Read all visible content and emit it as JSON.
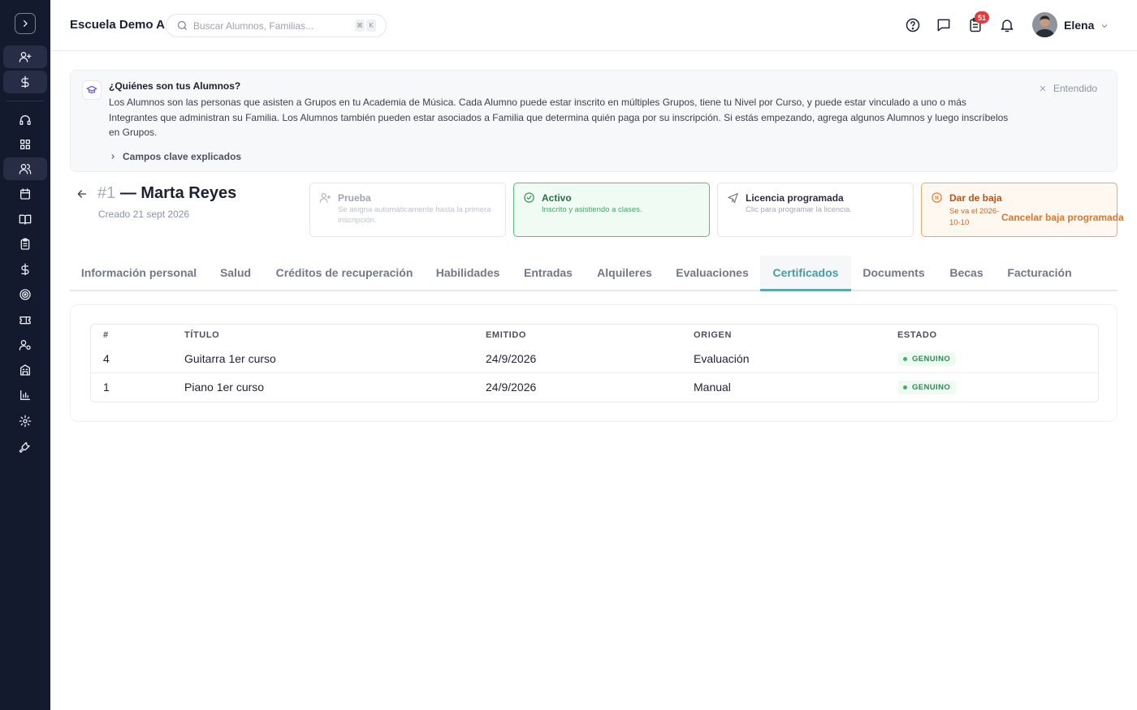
{
  "app": {
    "school_name": "Escuela Demo A",
    "search": {
      "placeholder": "Buscar Alumnos, Familias...",
      "shortcut": [
        "⌘",
        "K"
      ]
    },
    "notifications_count": "51",
    "user": {
      "name": "Elena"
    }
  },
  "sidebar": {
    "items": [
      {
        "icon": "user-plus-icon"
      },
      {
        "icon": "dollar-icon"
      },
      {
        "icon": "headset-icon"
      },
      {
        "icon": "dashboard-icon"
      },
      {
        "icon": "users-icon",
        "active": true
      },
      {
        "icon": "calendar-icon"
      },
      {
        "icon": "book-icon"
      },
      {
        "icon": "clipboard-icon"
      },
      {
        "icon": "dollar-icon"
      },
      {
        "icon": "target-icon"
      },
      {
        "icon": "ticket-icon"
      },
      {
        "icon": "user-settings-icon"
      },
      {
        "icon": "building-icon"
      },
      {
        "icon": "bar-chart-icon"
      },
      {
        "icon": "gear-icon"
      },
      {
        "icon": "wrench-icon"
      }
    ]
  },
  "banner": {
    "title": "¿Quiénes son tus Alumnos?",
    "text": "Los Alumnos son las personas que asisten a Grupos en tu Academia de Música. Cada Alumno puede estar inscrito en múltiples Grupos, tiene tu Nivel por Curso, y puede estar vinculado a uno o más Integrantes que administran su Familia. Los Alumnos también pueden estar asociados a Familia que determina quién paga por su inscripción. Si estás empezando, agrega algunos Alumnos y luego inscríbelos en Grupos.",
    "more_label": "Campos clave explicados",
    "dismiss_label": "Entendido"
  },
  "student": {
    "number": "#1",
    "name": "— Marta Reyes",
    "created": "Creado 21 sept 2026"
  },
  "status_cards": [
    {
      "title": "Prueba",
      "desc": "Se asigna automáticamente hasta la primera inscripción."
    },
    {
      "title": "Activo",
      "desc": "Inscrito y asistiendo a clases."
    },
    {
      "title": "Licencia programada",
      "desc": "Clic para programar la licencia."
    },
    {
      "title": "Dar de baja",
      "desc": "Se va el 2026-10-10"
    }
  ],
  "cancel_withdrawal_label": "Cancelar baja programada",
  "tabs": [
    "Información personal",
    "Salud",
    "Créditos de recuperación",
    "Habilidades",
    "Entradas",
    "Alquileres",
    "Evaluaciones",
    "Certificados",
    "Documents",
    "Becas",
    "Facturación"
  ],
  "active_tab": "Certificados",
  "table": {
    "headers": [
      "#",
      "TÍTULO",
      "EMITIDO",
      "ORIGEN",
      "ESTADO"
    ],
    "rows": [
      {
        "num": "4",
        "title": "Guitarra 1er curso",
        "issued": "24/9/2026",
        "origin": "Evaluación",
        "status": "GENUINO"
      },
      {
        "num": "1",
        "title": "Piano 1er curso",
        "issued": "24/9/2026",
        "origin": "Manual",
        "status": "GENUINO"
      }
    ]
  },
  "colors": {
    "sidebar_bg": "#141a2e",
    "accent_teal": "#4a9ba3",
    "active_green": "#55c07a",
    "withdraw_orange": "#f0a765",
    "badge_red": "#e23b3b"
  }
}
